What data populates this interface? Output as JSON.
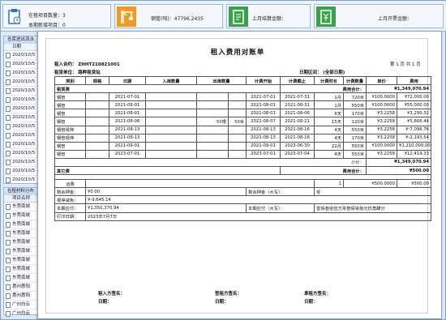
{
  "header": {
    "card1_line1": "在租项目数量：3",
    "card1_line2": "本期新增项目：0",
    "card2_line1": "钢管(吨)：47796.2435",
    "card3_line1": "上月结算金额：",
    "card4_line1": "上月开票金额：",
    "icon_card1": "clipboard-icon",
    "icon_card2": "crane-icon",
    "icon_card3": "document-icon",
    "icon_card4": "invoice-icon"
  },
  "sidebar": {
    "group1_title": "仓库进出流水",
    "group1_col": "日期",
    "group1_rows": [
      "2020/10/5",
      "2020/10/5",
      "2020/10/5",
      "2020/10/5",
      "2020/10/5",
      "2020/10/5",
      "2020/10/5",
      "2020/10/5",
      "2020/10/5",
      "2020/10/5",
      "2020/10/5",
      "2020/10/5",
      "2020/10/5",
      "2020/10/5",
      "2020/10/5"
    ],
    "group2_title": "在租材料分布",
    "group2_col": "项目名称",
    "group2_rows": [
      "东莞南城",
      "东莞南城",
      "东莞南城",
      "东莞南城",
      "东莞南城",
      "东莞南城",
      "东莞南城",
      "东莞南城",
      "东莞南城",
      "惠州惠阳",
      "惠州惠阳",
      "广州白云",
      "广州白云"
    ]
  },
  "report": {
    "title": "租入费用对账单",
    "contract_label": "租入合约：",
    "contract_value": "ZHHT210821001",
    "unit_label": "租赁单位：",
    "unit_value": "路畔租赁站",
    "page_info": "第 1 页 共 1 页",
    "date_label": "日期区间：",
    "date_value": "(全部日期)",
    "columns": [
      "类别",
      "规格",
      "日期",
      "入库数量",
      "出库数量",
      "计费开始",
      "计费截止",
      "计费时长",
      "计费数量",
      "单价",
      "费用"
    ],
    "section1_label": "租赁费",
    "section1_total_label": "费用合计：",
    "section1_total": "¥1,349,070.94",
    "rows": [
      {
        "c": "钢管",
        "s": "",
        "d": "2021-07-01",
        "i": "",
        "o": "",
        "o2": "",
        "start": "2021-07-01",
        "end": "2021-07-31",
        "dur": "1月",
        "qty": "720米",
        "price": "¥100.0000",
        "fee": "¥72,000.00"
      },
      {
        "c": "钢管",
        "s": "",
        "d": "2021-08-01",
        "i": "",
        "o": "",
        "o2": "",
        "start": "2021-08-01",
        "end": "2021-08-31",
        "dur": "1月",
        "qty": "550米",
        "price": "¥100.0000",
        "fee": "¥55,000.00"
      },
      {
        "c": "钢管",
        "s": "",
        "d": "2021-08-01",
        "i": "",
        "o": "",
        "o2": "",
        "start": "2021-08-01",
        "end": "2021-08-06",
        "dur": "6天",
        "qty": "170米",
        "price": "¥3.2258",
        "fee": "¥3,290.32"
      },
      {
        "c": "钢管",
        "s": "",
        "d": "2021-08-06",
        "i": "",
        "o": "50根",
        "o2": "50米",
        "start": "2021-08-07",
        "end": "2021-08-21",
        "dur": "15天",
        "qty": "120米",
        "price": "¥3.2258",
        "fee": "¥5,806.44"
      },
      {
        "c": "钢管报停",
        "s": "",
        "d": "2021-08-13",
        "i": "",
        "o": "",
        "o2": "",
        "start": "2021-08-13",
        "end": "2021-08-16",
        "dur": "4天",
        "qty": "550米",
        "price": "¥3.2258",
        "fee": "¥-7,096.76"
      },
      {
        "c": "钢管报停",
        "s": "",
        "d": "2021-08-13",
        "i": "",
        "o": "",
        "o2": "",
        "start": "2021-08-13",
        "end": "2021-08-16",
        "dur": "4天",
        "qty": "170米",
        "price": "¥3.2258",
        "fee": "¥-2,193.54"
      },
      {
        "c": "钢管",
        "s": "",
        "d": "2021-09-01",
        "i": "",
        "o": "",
        "o2": "",
        "start": "2021-09-01",
        "end": "2023-06-30",
        "dur": "22月",
        "qty": "550米",
        "price": "¥100.0000",
        "fee": "¥1,210,000.00"
      },
      {
        "c": "钢管",
        "s": "",
        "d": "2023-07-01",
        "i": "",
        "o": "",
        "o2": "",
        "start": "2023-07-01",
        "end": "2023-07-04",
        "dur": "4天",
        "qty": "550米",
        "price": "¥3.2258",
        "fee": "¥12,419.33"
      }
    ],
    "subtotal_label": "小计：",
    "subtotal": "¥1,349,070.94",
    "section2_label": "其它费",
    "section2_total_label": "费用合计：",
    "section2_total": "¥500.00",
    "other_row": {
      "c": "运费",
      "qty": "1",
      "price": "¥500.0000",
      "fee": "¥500.00"
    },
    "remaining_deposit_label": "剩余押金：",
    "remaining_deposit": "¥0.00",
    "remaining_deposit_cn_label": "剩余押金（大写）：",
    "remaining_deposit_cn": "零",
    "deduction_label": "报停减免：",
    "deduction": "¥-9,645.14",
    "payable_label": "本期应付：",
    "payable": "¥1,350,370.94",
    "payable_cn_label": "本期应付（大写）：",
    "payable_cn": "壹佰叁拾伍万零叁佰柒拾元玖角肆分",
    "print_date_label": "打印日期：",
    "print_date": "2023年7月7日",
    "sign1": "租入方签名：",
    "sign2": "签租方签名：",
    "sign3": "承租方签名：",
    "date_sig": "日期："
  }
}
